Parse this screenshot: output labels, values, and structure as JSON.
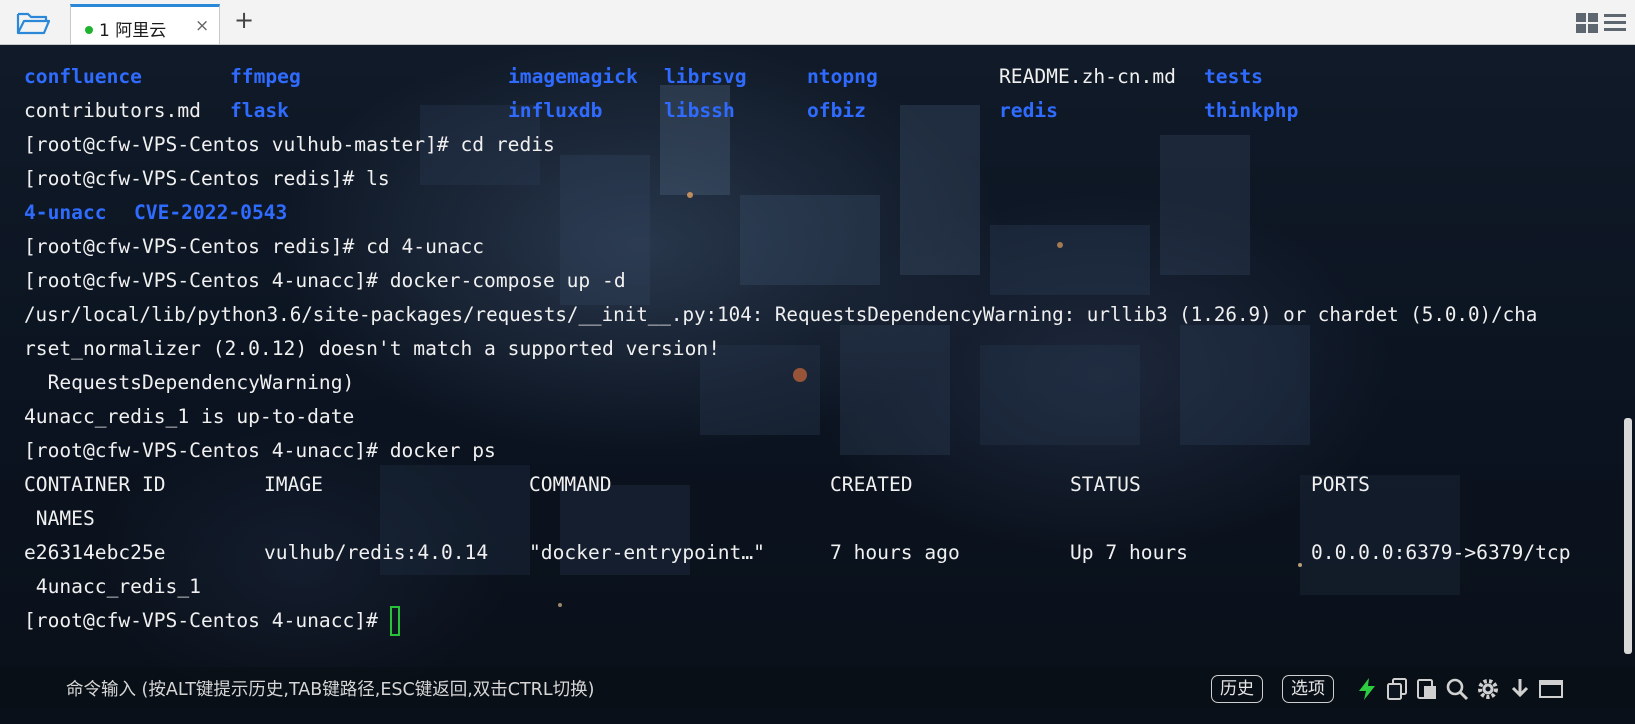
{
  "tabbar": {
    "tab": {
      "index": "1",
      "title": "阿里云",
      "close": "×",
      "status": "connected"
    },
    "add_tab": "+"
  },
  "terminal": {
    "listing": {
      "row1": [
        "confluence",
        "ffmpeg",
        "imagemagick",
        "librsvg",
        "ntopng",
        "README.zh-cn.md",
        "tests"
      ],
      "row2": [
        "contributors.md",
        "flask",
        "influxdb",
        "libssh",
        "ofbiz",
        "redis",
        "thinkphp"
      ]
    },
    "prompt_cd_redis": "[root@cfw-VPS-Centos vulhub-master]# cd redis",
    "prompt_ls": "[root@cfw-VPS-Centos redis]# ls",
    "ls_output": [
      "4-unacc",
      "CVE-2022-0543"
    ],
    "prompt_cd_unacc": "[root@cfw-VPS-Centos redis]# cd 4-unacc",
    "prompt_compose": "[root@cfw-VPS-Centos 4-unacc]# docker-compose up -d",
    "warning_line1": "/usr/local/lib/python3.6/site-packages/requests/__init__.py:104: RequestsDependencyWarning: urllib3 (1.26.9) or chardet (5.0.0)/cha",
    "warning_line2": "rset_normalizer (2.0.12) doesn't match a supported version!",
    "warning_line3": "  RequestsDependencyWarning)",
    "compose_result": "4unacc_redis_1 is up-to-date",
    "prompt_ps": "[root@cfw-VPS-Centos 4-unacc]# docker ps",
    "ps_headers": [
      "CONTAINER ID",
      "IMAGE",
      "COMMAND",
      "CREATED",
      "STATUS",
      "PORTS"
    ],
    "ps_headers_wrap": " NAMES",
    "ps_row": [
      "e26314ebc25e",
      "vulhub/redis:4.0.14",
      "\"docker-entrypoint…\"",
      "7 hours ago",
      "Up 7 hours",
      "0.0.0.0:6379->6379/tcp"
    ],
    "ps_row_wrap": " 4unacc_redis_1",
    "final_prompt": "[root@cfw-VPS-Centos 4-unacc]# "
  },
  "cmdbar": {
    "hint": "命令输入 (按ALT键提示历史,TAB键路径,ESC键返回,双击CTRL切换)",
    "history_label": "历史",
    "options_label": "选项"
  },
  "colors": {
    "directory": "#2f6bff",
    "text": "#f0f0f0",
    "cursor": "#27c23a",
    "tab_accent": "#2b88d8",
    "status_dot": "#1fb32e",
    "lightning": "#2ecc40"
  },
  "icons": [
    "folder-open-icon",
    "layout-grid-icon",
    "menu-icon",
    "lightning-icon",
    "copy-icon",
    "paste-icon",
    "search-icon",
    "gear-icon",
    "download-icon",
    "window-icon"
  ]
}
